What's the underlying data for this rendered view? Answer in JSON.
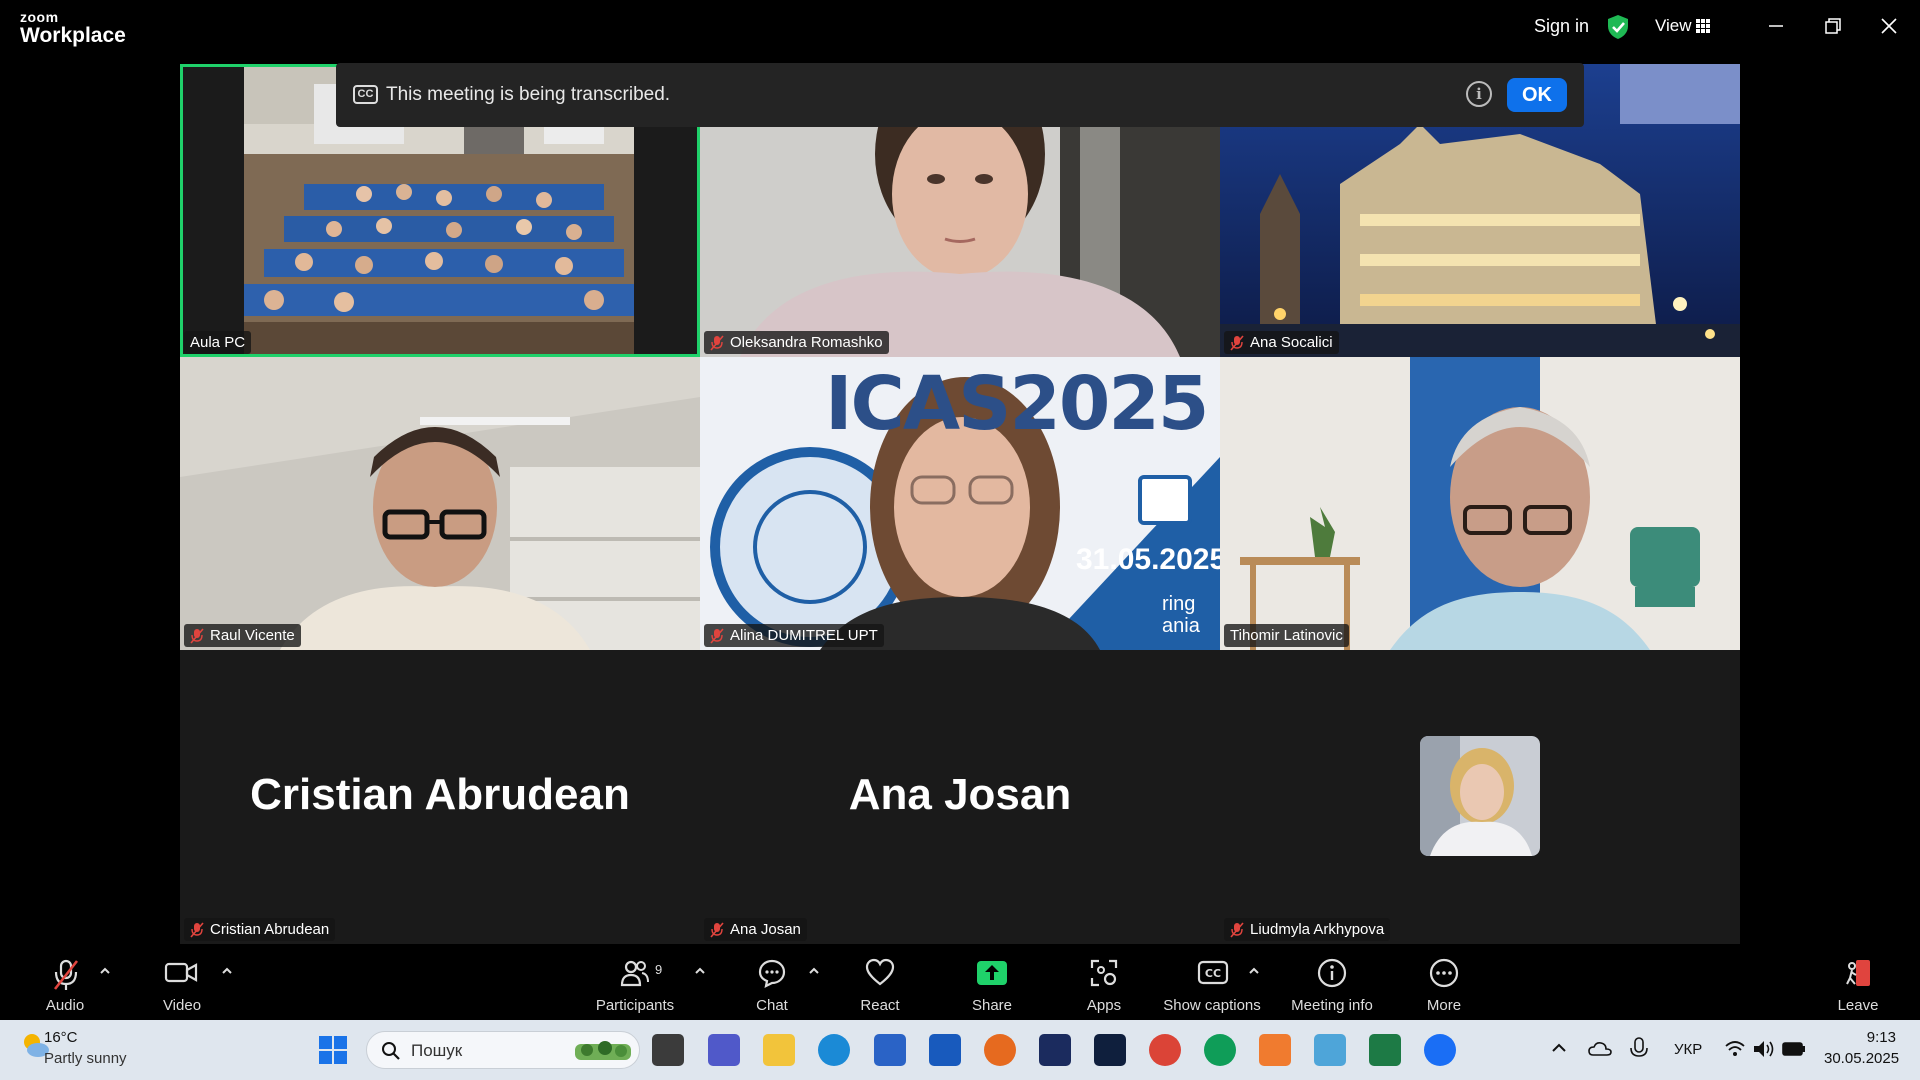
{
  "window": {
    "brand_top": "zoom",
    "brand_bottom": "Workplace",
    "sign_in": "Sign in",
    "view": "View"
  },
  "notice": {
    "cc": "CC",
    "text": "This meeting is being transcribed.",
    "info": "i",
    "ok": "OK"
  },
  "tiles": {
    "t1": "Aula PC",
    "t2": "Oleksandra Romashko",
    "t3": "Ana Socalici",
    "t4": "Raul Vicente",
    "t5": "Alina DUMITREL UPT",
    "t6": "Tihomir Latinovic",
    "t7": "Cristian Abrudean",
    "t8": "Ana Josan",
    "t9": "Liudmyla Arkhypova"
  },
  "slide": {
    "brand": "ICAS2025",
    "date": "31.05.2025",
    "frag1": "ring",
    "frag2": "ania"
  },
  "toolbar": {
    "audio": "Audio",
    "video": "Video",
    "participants": "Participants",
    "participants_count": "9",
    "chat": "Chat",
    "react": "React",
    "share": "Share",
    "apps": "Apps",
    "captions": "Show captions",
    "meeting_info": "Meeting info",
    "more": "More",
    "leave": "Leave"
  },
  "taskbar": {
    "temp": "16°C",
    "weather": "Partly sunny",
    "search": "Пошук",
    "lang": "УКР",
    "time": "9:13",
    "date": "30.05.2025"
  }
}
